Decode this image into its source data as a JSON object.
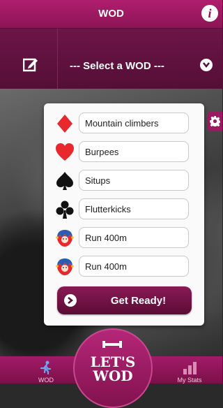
{
  "header": {
    "title": "WOD",
    "info_label": "i"
  },
  "selector": {
    "placeholder": "--- Select a WOD ---"
  },
  "exercises": [
    {
      "suit": "diamond",
      "color": "#e8282d",
      "name": "Mountain climbers"
    },
    {
      "suit": "heart",
      "color": "#e8282d",
      "name": "Burpees"
    },
    {
      "suit": "spade",
      "color": "#111111",
      "name": "Situps"
    },
    {
      "suit": "club",
      "color": "#111111",
      "name": "Flutterkicks"
    },
    {
      "suit": "joker",
      "color": "#2a5db0",
      "name": "Run 400m"
    },
    {
      "suit": "joker",
      "color": "#2a5db0",
      "name": "Run 400m"
    }
  ],
  "action": {
    "label": "Get Ready!"
  },
  "tabbar": {
    "left_label": "WOD",
    "center_line1": "LET'S",
    "center_line2": "WOD",
    "right_label": "My Stats"
  },
  "colors": {
    "brand": "#8c1456",
    "brand_dark": "#540f36",
    "suit_red": "#e8282d"
  }
}
